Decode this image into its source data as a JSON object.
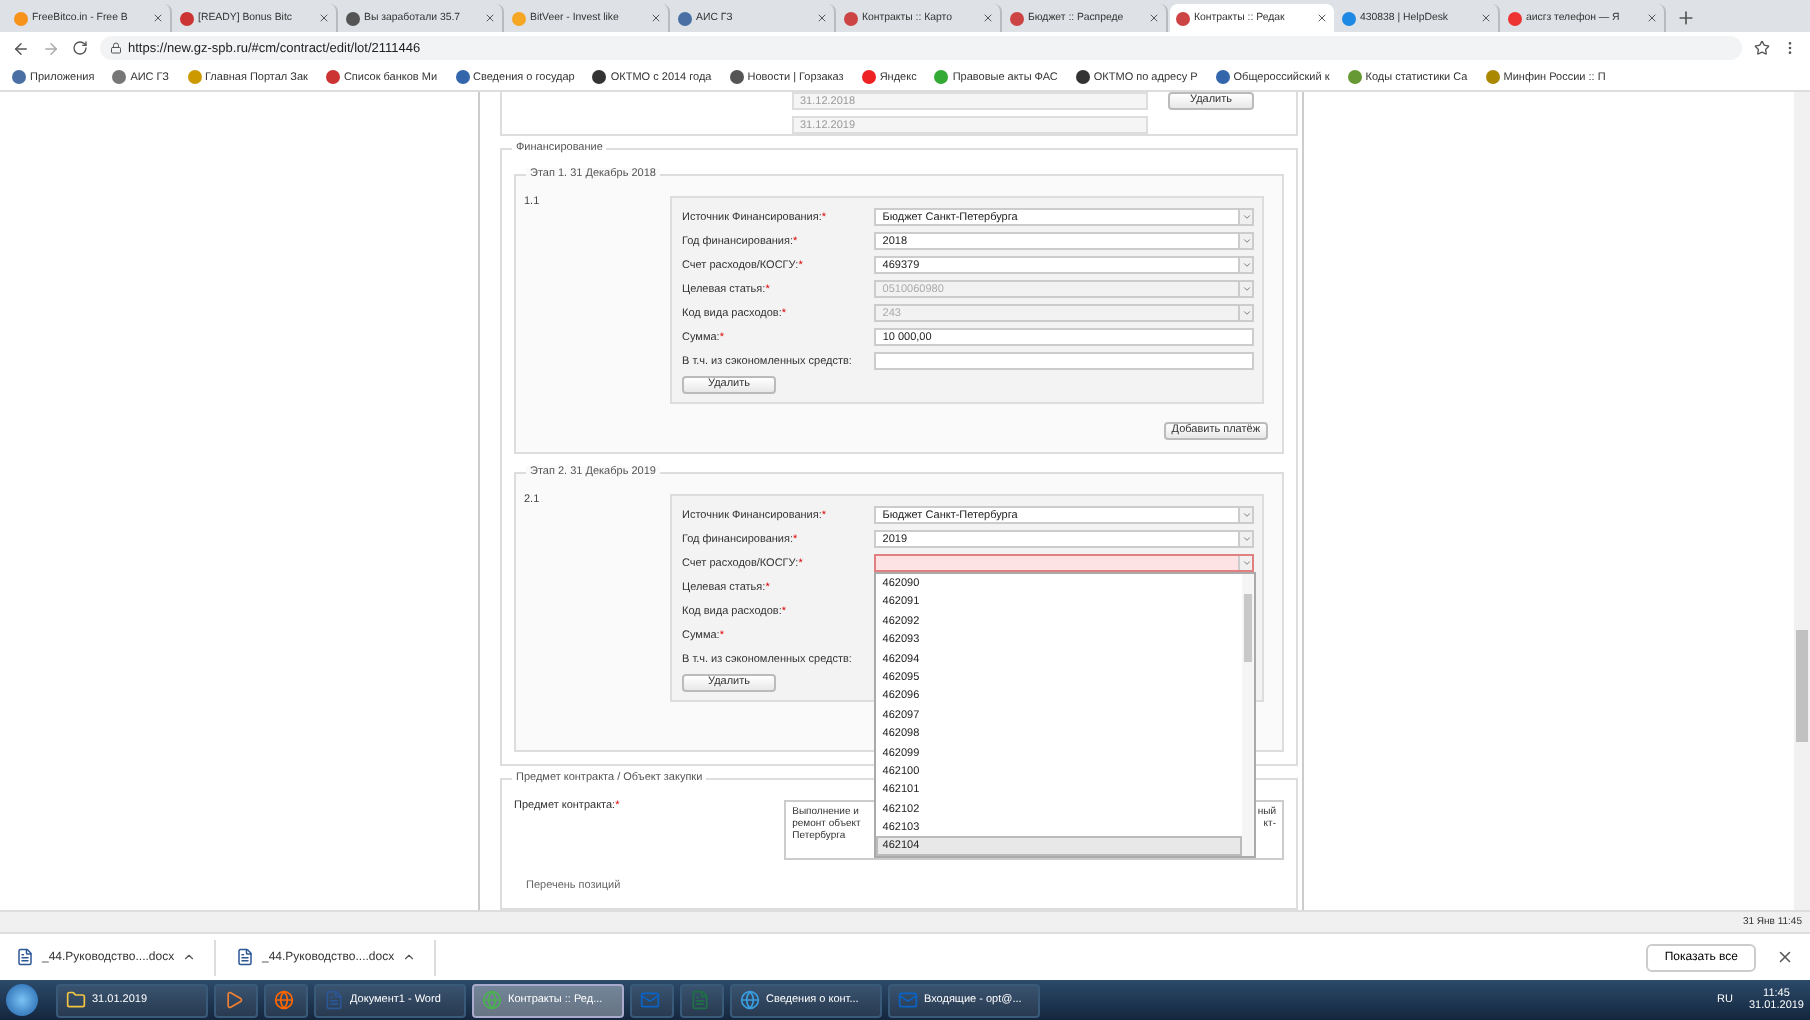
{
  "browser": {
    "tabs": [
      {
        "title": "FreeBitco.in - Free B",
        "selected": false
      },
      {
        "title": "[READY] Bonus Bitc",
        "selected": false
      },
      {
        "title": "Вы заработали 35.7",
        "selected": false
      },
      {
        "title": "BitVeer - Invest like",
        "selected": false
      },
      {
        "title": "АИС ГЗ",
        "selected": false
      },
      {
        "title": "Контракты :: Карто",
        "selected": false
      },
      {
        "title": "Бюджет :: Распреде",
        "selected": false
      },
      {
        "title": "Контракты :: Редак",
        "selected": true
      },
      {
        "title": "430838 | HelpDesk",
        "selected": false
      },
      {
        "title": "аисгз телефон — Я",
        "selected": false
      }
    ],
    "url": "https://new.gz-spb.ru/#cm/contract/edit/lot/2111446",
    "bookmarks": [
      "Приложения",
      "АИС ГЗ",
      "Главная Портал Зак",
      "Список банков Ми",
      "Сведения о государ",
      "ОКТМО с 2014 года",
      "Новости | Горзаказ",
      "Яндекс",
      "Правовые акты ФАС",
      "ОКТМО по адресу Р",
      "Общероссийский к",
      "Коды статистики Са",
      "Минфин России :: П"
    ]
  },
  "top_section": {
    "dates": [
      "31.12.2018",
      "31.12.2019"
    ],
    "delete_button": "Удалить"
  },
  "financing": {
    "legend": "Финансирование",
    "stages": [
      {
        "legend": "Этап 1. 31 Декабрь 2018",
        "number": "1.1",
        "delete_button": "Удалить",
        "add_button": "Добавить платёж",
        "rows": [
          {
            "label": "Источник Финансирования:",
            "required_mark": "*",
            "kind": "select",
            "value": "Бюджет Санкт-Петербурга",
            "disabled": false,
            "error": false
          },
          {
            "label": "Год финансирования:",
            "required_mark": "*",
            "kind": "select",
            "value": "2018",
            "disabled": false,
            "error": false
          },
          {
            "label": "Счет расходов/КОСГУ:",
            "required_mark": "*",
            "kind": "select",
            "value": "469379",
            "disabled": false,
            "error": false
          },
          {
            "label": "Целевая статья:",
            "required_mark": "*",
            "kind": "select",
            "value": "0510060980",
            "disabled": true,
            "error": false
          },
          {
            "label": "Код вида расходов:",
            "required_mark": "*",
            "kind": "select",
            "value": "243",
            "disabled": true,
            "error": false
          },
          {
            "label": "Сумма:",
            "required_mark": "*",
            "kind": "input",
            "value": "10 000,00",
            "disabled": false,
            "error": false
          },
          {
            "label": "В т.ч. из сэкономленных средств:",
            "kind": "input",
            "disabled": false,
            "error": false
          }
        ]
      },
      {
        "legend": "Этап 2. 31 Декабрь 2019",
        "number": "2.1",
        "delete_button": "Удалить",
        "rows": [
          {
            "label": "Источник Финансирования:",
            "required_mark": "*",
            "kind": "select",
            "value": "Бюджет Санкт-Петербурга",
            "disabled": false,
            "error": false
          },
          {
            "label": "Год финансирования:",
            "required_mark": "*",
            "kind": "select",
            "value": "2019",
            "disabled": false,
            "error": false
          },
          {
            "label": "Счет расходов/КОСГУ:",
            "required_mark": "*",
            "kind": "select",
            "disabled": false,
            "error": true,
            "options": [
              {
                "label": "462090",
                "selected": false
              },
              {
                "label": "462091",
                "selected": false
              },
              {
                "label": "462092",
                "selected": false
              },
              {
                "label": "462093",
                "selected": false
              },
              {
                "label": "462094",
                "selected": false
              },
              {
                "label": "462095",
                "selected": false
              },
              {
                "label": "462096",
                "selected": false
              },
              {
                "label": "462097",
                "selected": false
              },
              {
                "label": "462098",
                "selected": false
              },
              {
                "label": "462099",
                "selected": false
              },
              {
                "label": "462100",
                "selected": false
              },
              {
                "label": "462101",
                "selected": false
              },
              {
                "label": "462102",
                "selected": false
              },
              {
                "label": "462103",
                "selected": false
              },
              {
                "label": "462104",
                "selected": true
              }
            ]
          },
          {
            "label": "Целевая статья:",
            "required_mark": "*",
            "kind": "select"
          },
          {
            "label": "Код вида расходов:",
            "required_mark": "*",
            "kind": "select"
          },
          {
            "label": "Сумма:",
            "required_mark": "*",
            "kind": "input"
          },
          {
            "label": "В т.ч. из сэкономленных средств:",
            "kind": "input"
          }
        ]
      }
    ]
  },
  "subject": {
    "legend": "Предмет контракта / Объект закупки",
    "label": "Предмет контракта:",
    "required_mark": "*",
    "text_left": [
      "Выполнение и",
      "ремонт объект",
      "Петербурга"
    ],
    "text_right": [
      "ный",
      "кт-"
    ],
    "next_legend": "Перечень позиций"
  },
  "status_bar": {
    "time": "31 Янв 11:45"
  },
  "downloads": {
    "files": [
      "_44.Руководство....docx",
      "_44.Руководство....docx"
    ],
    "show_all": "Показать все"
  },
  "taskbar": {
    "items": [
      {
        "kind": "folder",
        "label": "31.01.2019",
        "selected": false
      },
      {
        "kind": "media",
        "selected": false
      },
      {
        "kind": "firefox",
        "selected": false
      },
      {
        "kind": "word",
        "label": "Документ1 - Word",
        "selected": false
      },
      {
        "kind": "chrome",
        "label": "Контракты :: Ред...",
        "selected": true
      },
      {
        "kind": "outlook",
        "selected": false
      },
      {
        "kind": "excel",
        "selected": false
      },
      {
        "kind": "ie",
        "label": "Сведения о конт...",
        "selected": false
      },
      {
        "kind": "outlook",
        "label": "Входящие - opt@...",
        "selected": false
      }
    ],
    "lang": "RU",
    "time": "11:45",
    "date": "31.01.2019"
  }
}
